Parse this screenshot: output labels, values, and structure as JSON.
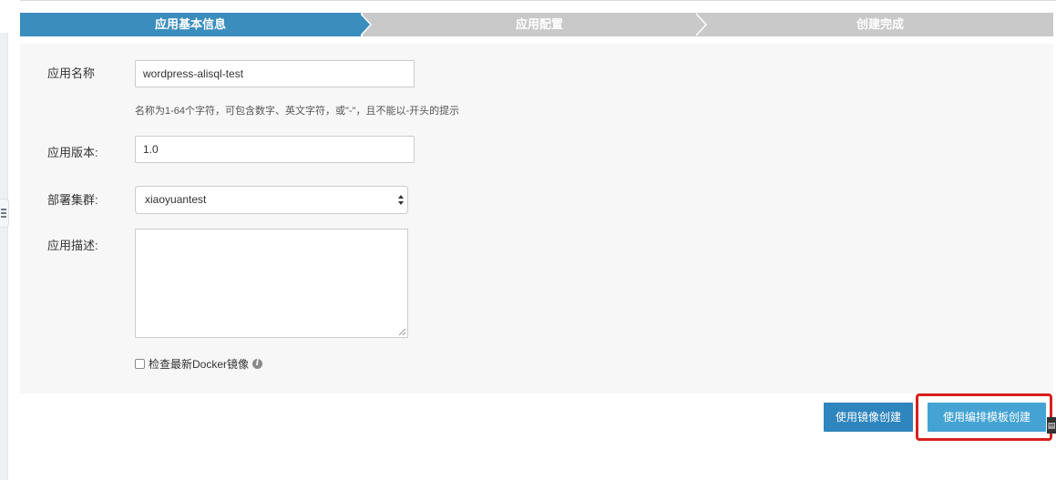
{
  "steps": [
    {
      "label": "应用基本信息",
      "active": true
    },
    {
      "label": "应用配置",
      "active": false
    },
    {
      "label": "创建完成",
      "active": false
    }
  ],
  "form": {
    "app_name": {
      "label": "应用名称",
      "value": "wordpress-alisql-test",
      "hint": "名称为1-64个字符，可包含数字、英文字符，或\"-\"，且不能以-开头的提示"
    },
    "app_version": {
      "label": "应用版本:",
      "value": "1.0"
    },
    "cluster": {
      "label": "部署集群:",
      "selected": "xiaoyuantest"
    },
    "description": {
      "label": "应用描述:",
      "value": ""
    },
    "check_docker": {
      "label": "检查最新Docker镜像",
      "checked": false
    }
  },
  "buttons": {
    "create_from_image": "使用镜像创建",
    "create_from_template": "使用编排模板创建"
  },
  "colors": {
    "step_active": "#3a8dbd",
    "step_inactive": "#c9c9c9",
    "primary_button": "#2f85bd",
    "template_button": "#44a3d3",
    "highlight": "#d71f1f"
  },
  "icons": {
    "info": "info-icon",
    "sidebar_toggle": "menu-icon",
    "select_arrows": "select-arrows-icon"
  }
}
